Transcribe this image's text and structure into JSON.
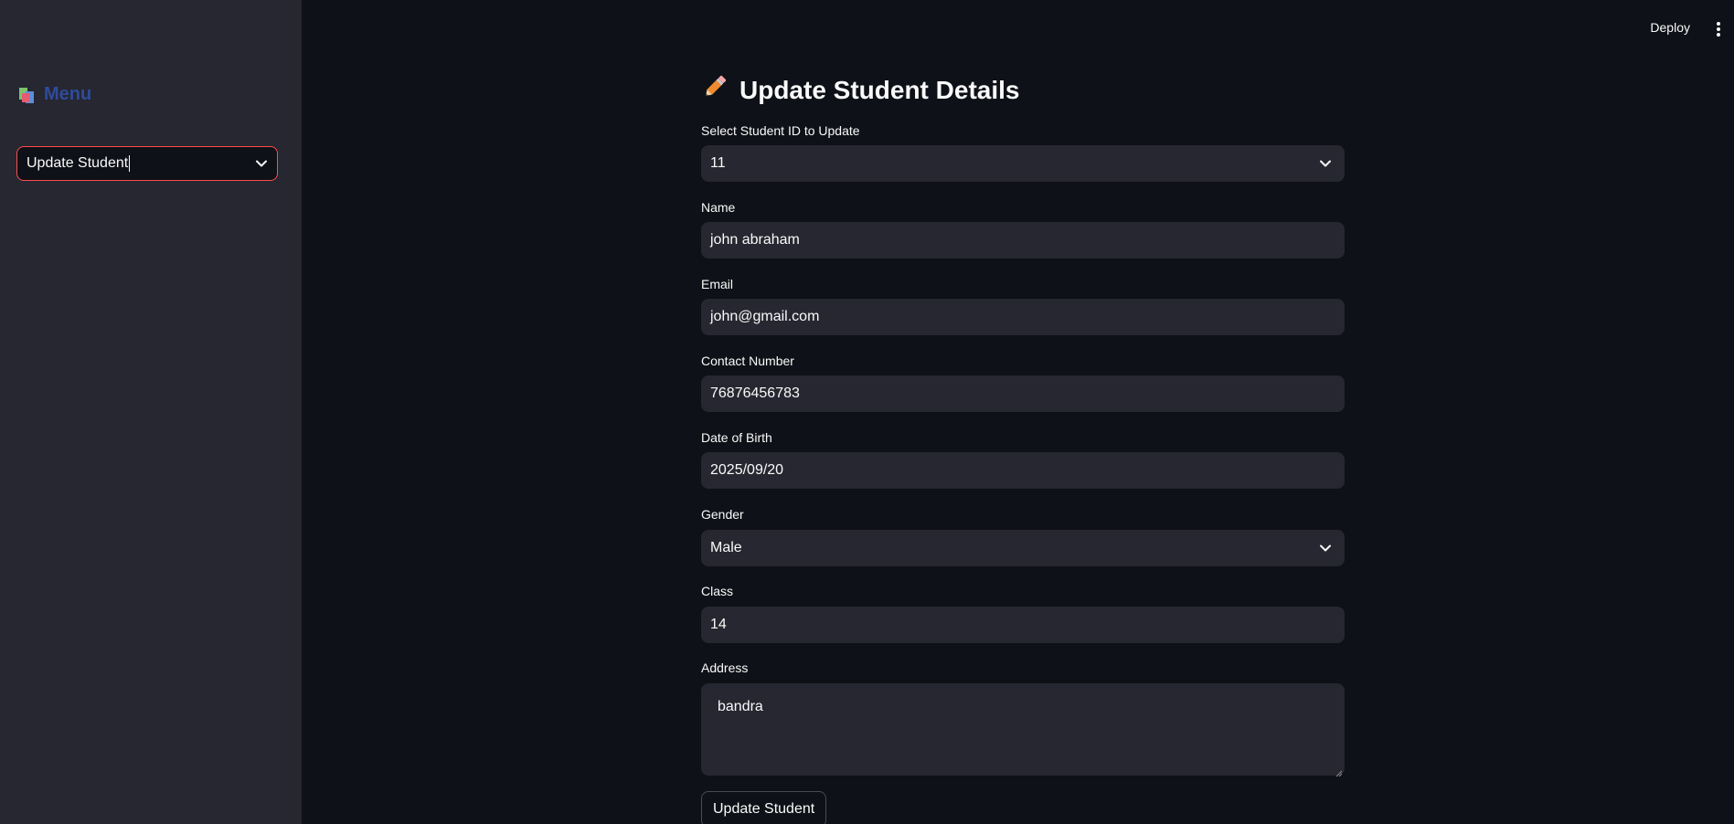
{
  "header": {
    "deploy_label": "Deploy",
    "more_icon": "kebab-vertical-icon"
  },
  "sidebar": {
    "menu_icon": "books-icon",
    "menu_title": "Menu",
    "nav_select": {
      "value": "Update Student",
      "focused": true,
      "accent": "#ff4b4b"
    }
  },
  "main": {
    "title_icon": "pencil-icon",
    "title": "Update Student Details",
    "fields": {
      "student_id": {
        "label": "Select Student ID to Update",
        "value": "11"
      },
      "name": {
        "label": "Name",
        "value": "john abraham"
      },
      "email": {
        "label": "Email",
        "value": "john@gmail.com"
      },
      "contact": {
        "label": "Contact Number",
        "value": "76876456783"
      },
      "dob": {
        "label": "Date of Birth",
        "value": "2025/09/20"
      },
      "gender": {
        "label": "Gender",
        "value": "Male"
      },
      "class": {
        "label": "Class",
        "value": "14"
      },
      "address": {
        "label": "Address",
        "value": "bandra"
      }
    },
    "submit_label": "Update Student"
  },
  "colors": {
    "background": "#0e1117",
    "sidebar": "#262730",
    "input": "#262730",
    "accent": "#ff4b4b",
    "menu_title": "#2f4b9c"
  }
}
